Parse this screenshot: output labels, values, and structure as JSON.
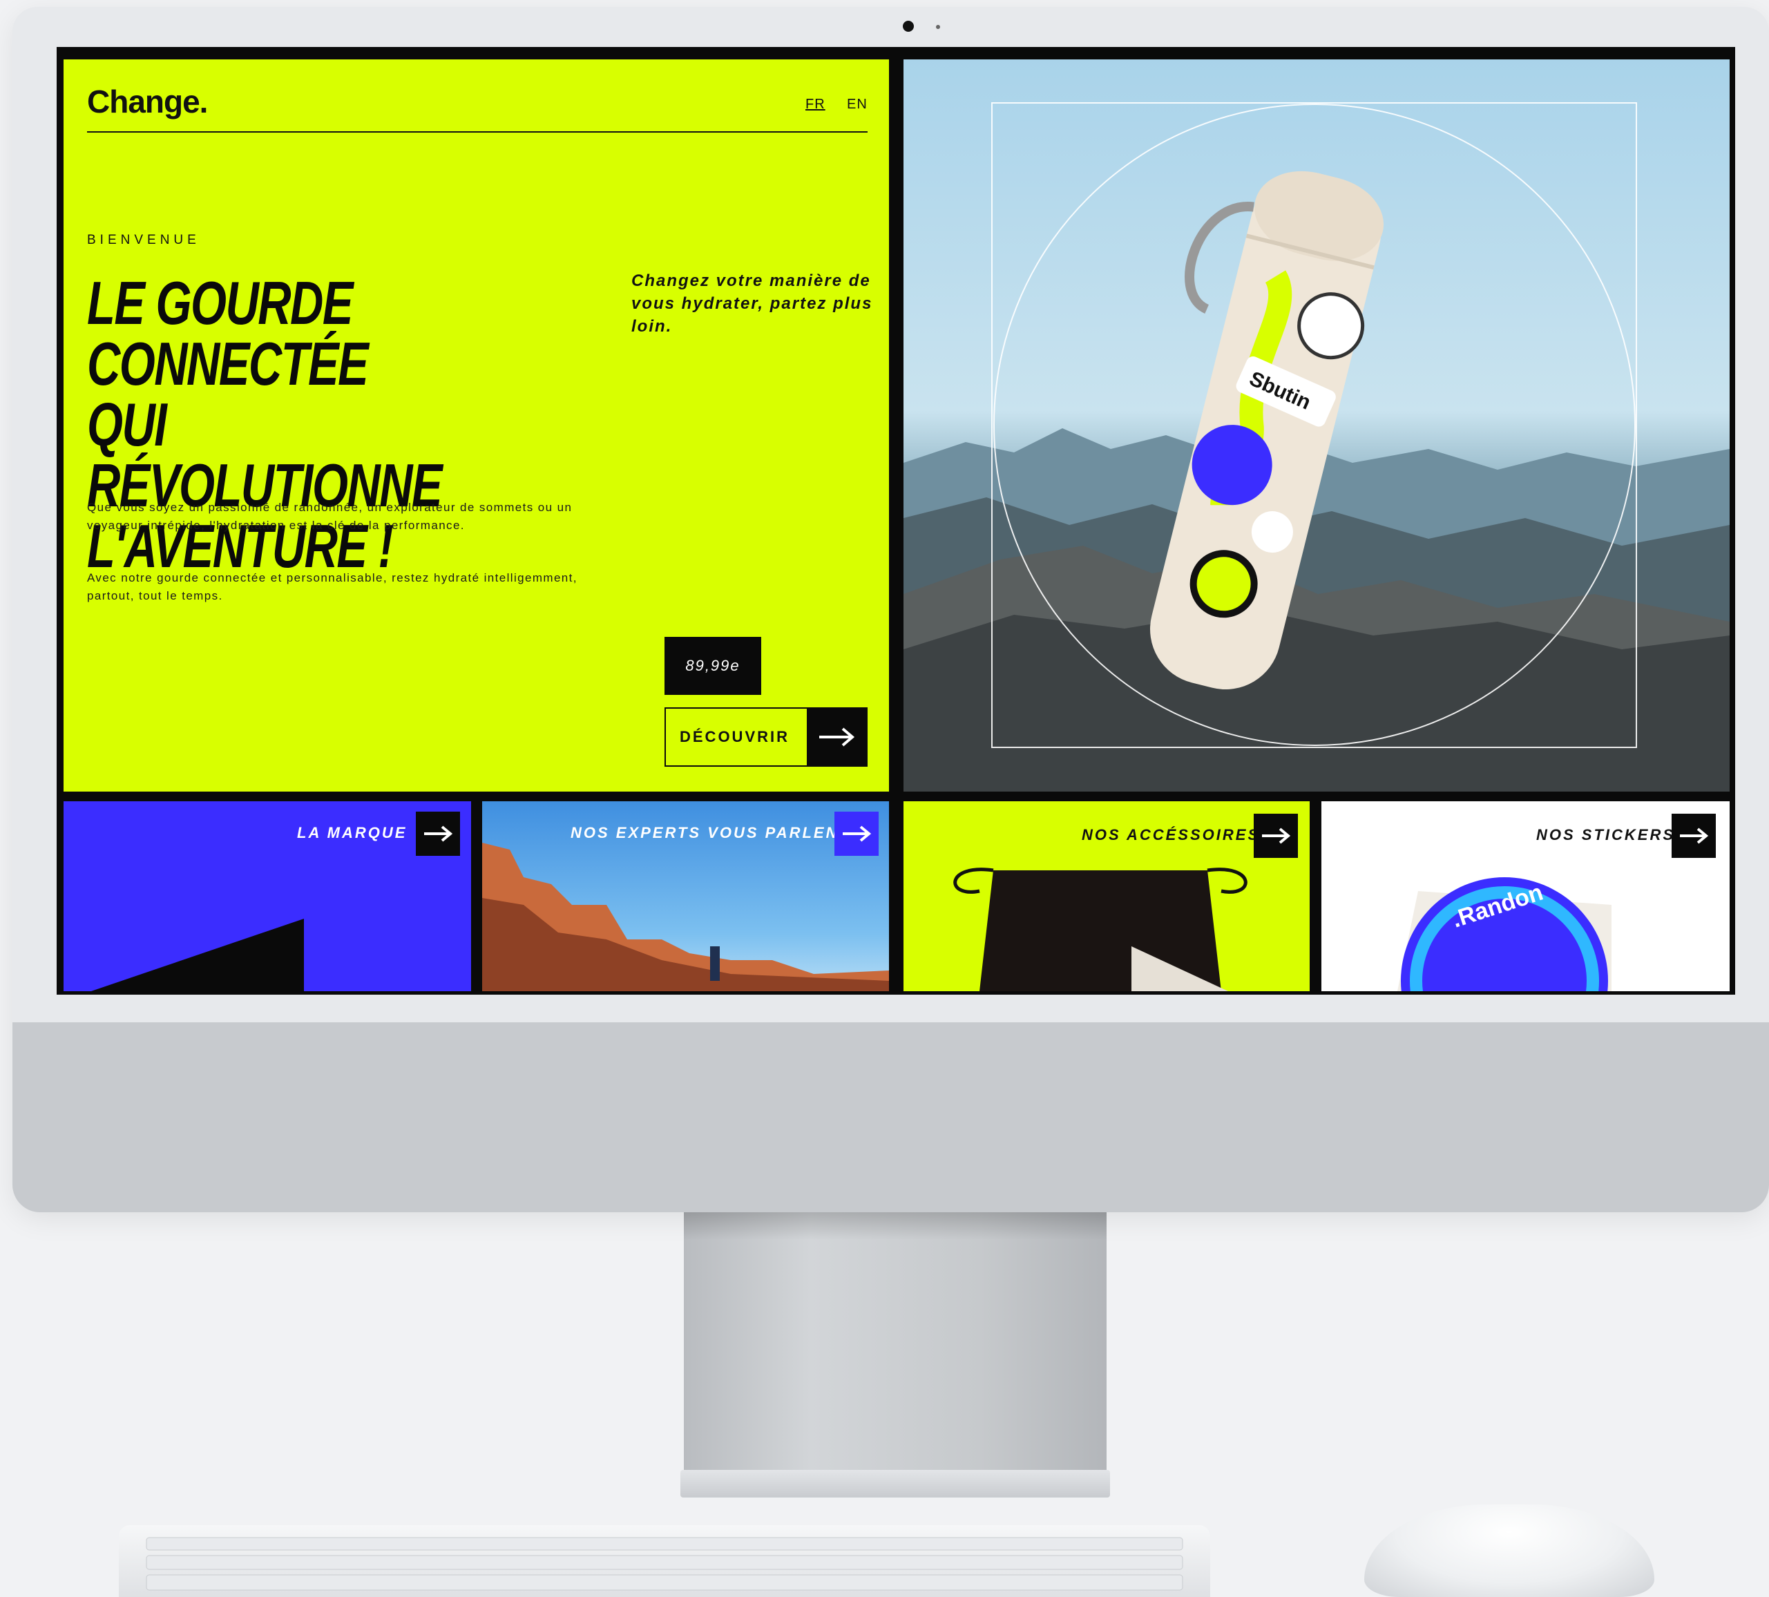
{
  "brand": {
    "logo": "Change."
  },
  "languages": {
    "fr": "FR",
    "en": "EN"
  },
  "hero": {
    "kicker": "BIENVENUE",
    "headline": [
      "LE GOURDE CONNECTÉE",
      "QUI RÉVOLUTIONNE",
      "L'AVENTURE !"
    ],
    "tagline": "Changez votre manière de vous hydrater, partez plus loin.",
    "body_1": "Que vous soyez un passionné de randonnée, un explorateur de sommets ou un voyageur intrépide, l'hydratation est la clé de la performance.",
    "body_2": "Avec notre gourde connectée et personnalisable, restez hydraté intelligemment, partout, tout le temps.",
    "price": "89,99e",
    "cta_label": "DÉCOUVRIR"
  },
  "tiles": [
    {
      "label": "LA MARQUE"
    },
    {
      "label": "NOS EXPERTS VOUS PARLENT"
    },
    {
      "label": "NOS ACCÉSSOIRES"
    },
    {
      "label": "NOS STICKERS"
    }
  ],
  "product_image": {
    "sticker_text": "Sbutin",
    "sticker_text_2": ".Randon"
  },
  "icons": [
    "arrow-right-icon",
    "camera-icon"
  ],
  "colors": {
    "lime": "#d8ff00",
    "blue": "#3b2dff",
    "black": "#0a0a0a",
    "white": "#ffffff"
  }
}
